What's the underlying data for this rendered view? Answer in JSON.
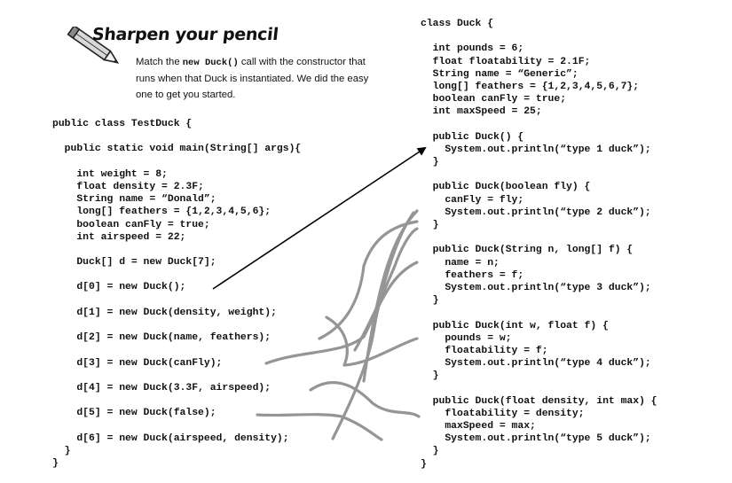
{
  "header": {
    "title": "Sharpen your pencil",
    "instructions_before": "Match the ",
    "instructions_code": "new Duck()",
    "instructions_after": " call with the constructor that runs when that Duck is instantiated. We did the easy one to get you started."
  },
  "left_code": [
    "public class TestDuck {",
    "",
    "  public static void main(String[] args){",
    "",
    "    int weight = 8;",
    "    float density = 2.3F;",
    "    String name = “Donald”;",
    "    long[] feathers = {1,2,3,4,5,6};",
    "    boolean canFly = true;",
    "    int airspeed = 22;",
    "",
    "    Duck[] d = new Duck[7];",
    "",
    "    d[0] = new Duck();",
    "",
    "    d[1] = new Duck(density, weight);",
    "",
    "    d[2] = new Duck(name, feathers);",
    "",
    "    d[3] = new Duck(canFly);",
    "",
    "    d[4] = new Duck(3.3F, airspeed);",
    "",
    "    d[5] = new Duck(false);",
    "",
    "    d[6] = new Duck(airspeed, density);",
    "  }",
    "}"
  ],
  "right_code": [
    "class Duck {",
    "",
    "  int pounds = 6;",
    "  float floatability = 2.1F;",
    "  String name = “Generic”;",
    "  long[] feathers = {1,2,3,4,5,6,7};",
    "  boolean canFly = true;",
    "  int maxSpeed = 25;",
    "",
    "  public Duck() {",
    "    System.out.println(“type 1 duck”);",
    "  }",
    "",
    "  public Duck(boolean fly) {",
    "    canFly = fly;",
    "    System.out.println(“type 2 duck”);",
    "  }",
    "",
    "  public Duck(String n, long[] f) {",
    "    name = n;",
    "    feathers = f;",
    "    System.out.println(“type 3 duck”);",
    "  }",
    "",
    "  public Duck(int w, float f) {",
    "    pounds = w;",
    "    floatability = f;",
    "    System.out.println(“type 4 duck”);",
    "  }",
    "",
    "  public Duck(float density, int max) {",
    "    floatability = density;",
    "    maxSpeed = max;",
    "    System.out.println(“type 5 duck”);",
    "  }",
    "}"
  ],
  "colors": {
    "text": "#111111",
    "answer_arrow": "#000000",
    "pencil_lines": "#8a8a8a"
  },
  "icons": {
    "pencil": "pencil-icon"
  }
}
